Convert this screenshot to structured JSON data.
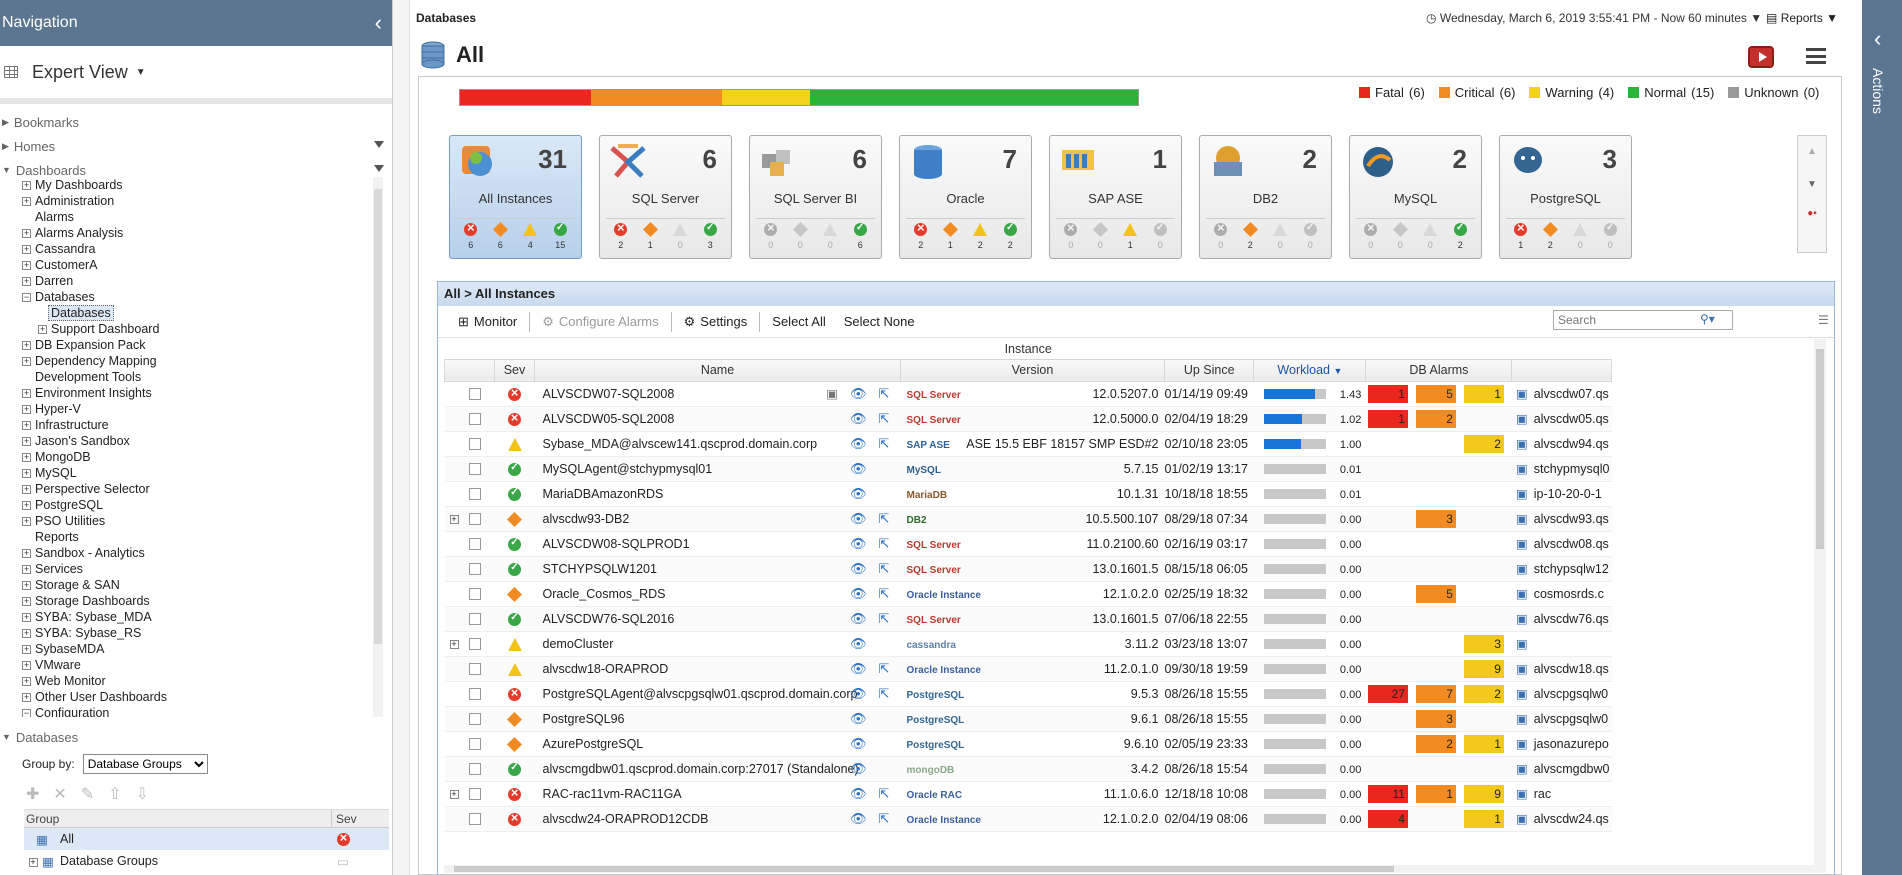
{
  "nav": {
    "title": "Navigation",
    "view": "Expert View",
    "sections": {
      "bookmarks": "Bookmarks",
      "homes": "Homes",
      "dashboards": "Dashboards"
    },
    "dash_items": [
      {
        "label": "My Dashboards",
        "exp": "+",
        "indent": 1
      },
      {
        "label": "Administration",
        "exp": "+",
        "indent": 1
      },
      {
        "label": "Alarms",
        "exp": "",
        "indent": 1
      },
      {
        "label": "Alarms Analysis",
        "exp": "+",
        "indent": 1
      },
      {
        "label": "Cassandra",
        "exp": "+",
        "indent": 1
      },
      {
        "label": "CustomerA",
        "exp": "+",
        "indent": 1
      },
      {
        "label": "Darren",
        "exp": "+",
        "indent": 1
      },
      {
        "label": "Databases",
        "exp": "−",
        "indent": 1
      },
      {
        "label": "Databases",
        "exp": "",
        "indent": 2,
        "sel": true
      },
      {
        "label": "Support Dashboard",
        "exp": "+",
        "indent": 2
      },
      {
        "label": "DB Expansion Pack",
        "exp": "+",
        "indent": 1
      },
      {
        "label": "Dependency Mapping",
        "exp": "+",
        "indent": 1
      },
      {
        "label": "Development Tools",
        "exp": "",
        "indent": 1
      },
      {
        "label": "Environment Insights",
        "exp": "+",
        "indent": 1
      },
      {
        "label": "Hyper-V",
        "exp": "+",
        "indent": 1
      },
      {
        "label": "Infrastructure",
        "exp": "+",
        "indent": 1
      },
      {
        "label": "Jason's Sandbox",
        "exp": "+",
        "indent": 1
      },
      {
        "label": "MongoDB",
        "exp": "+",
        "indent": 1
      },
      {
        "label": "MySQL",
        "exp": "+",
        "indent": 1
      },
      {
        "label": "Perspective Selector",
        "exp": "+",
        "indent": 1
      },
      {
        "label": "PostgreSQL",
        "exp": "+",
        "indent": 1
      },
      {
        "label": "PSO Utilities",
        "exp": "+",
        "indent": 1
      },
      {
        "label": "Reports",
        "exp": "",
        "indent": 1
      },
      {
        "label": "Sandbox - Analytics",
        "exp": "+",
        "indent": 1
      },
      {
        "label": "Services",
        "exp": "+",
        "indent": 1
      },
      {
        "label": "Storage & SAN",
        "exp": "+",
        "indent": 1
      },
      {
        "label": "Storage Dashboards",
        "exp": "+",
        "indent": 1
      },
      {
        "label": "SYBA: Sybase_MDA",
        "exp": "+",
        "indent": 1
      },
      {
        "label": "SYBA: Sybase_RS",
        "exp": "+",
        "indent": 1
      },
      {
        "label": "SybaseMDA",
        "exp": "+",
        "indent": 1
      },
      {
        "label": "VMware",
        "exp": "+",
        "indent": 1
      },
      {
        "label": "Web Monitor",
        "exp": "+",
        "indent": 1
      },
      {
        "label": "Other User Dashboards",
        "exp": "+",
        "indent": 1
      },
      {
        "label": "Configuration",
        "exp": "−",
        "indent": 1
      }
    ],
    "db_section": "Databases",
    "group_by_label": "Group by:",
    "group_by_value": "Database Groups",
    "group_col": "Group",
    "sev_col": "Sev",
    "groups": [
      {
        "label": "All",
        "sel": true
      },
      {
        "label": "Database Groups",
        "sel": false
      }
    ]
  },
  "main": {
    "crumb": "Databases",
    "timerange": "Wednesday, March 6, 2019 3:55:41 PM - Now 60 minutes",
    "reports": "Reports",
    "title": "All"
  },
  "health": {
    "segments": [
      {
        "color": "#e8281f",
        "value": 6
      },
      {
        "color": "#f28b22",
        "value": 6
      },
      {
        "color": "#f2d21c",
        "value": 4
      },
      {
        "color": "#2db23a",
        "value": 15
      }
    ],
    "legend": [
      {
        "label": "Fatal",
        "count": "(6)",
        "color": "#e8281f"
      },
      {
        "label": "Critical",
        "count": "(6)",
        "color": "#f28b22"
      },
      {
        "label": "Warning",
        "count": "(4)",
        "color": "#f2d21c"
      },
      {
        "label": "Normal",
        "count": "(15)",
        "color": "#2db23a"
      },
      {
        "label": "Unknown",
        "count": "(0)",
        "color": "#999999"
      }
    ]
  },
  "tiles": [
    {
      "name": "All Instances",
      "count": "31",
      "sev": [
        "6",
        "6",
        "4",
        "15"
      ],
      "icon": "all-instances-icon",
      "sel": true
    },
    {
      "name": "SQL Server",
      "count": "6",
      "sev": [
        "2",
        "1",
        "0",
        "3"
      ],
      "icon": "sql-server-icon"
    },
    {
      "name": "SQL Server BI",
      "count": "6",
      "sev": [
        "0",
        "0",
        "0",
        "6"
      ],
      "icon": "sql-server-bi-icon"
    },
    {
      "name": "Oracle",
      "count": "7",
      "sev": [
        "2",
        "1",
        "2",
        "2"
      ],
      "icon": "oracle-icon"
    },
    {
      "name": "SAP ASE",
      "count": "1",
      "sev": [
        "0",
        "0",
        "1",
        "0"
      ],
      "icon": "sap-ase-icon"
    },
    {
      "name": "DB2",
      "count": "2",
      "sev": [
        "0",
        "2",
        "0",
        "0"
      ],
      "icon": "db2-icon"
    },
    {
      "name": "MySQL",
      "count": "2",
      "sev": [
        "0",
        "0",
        "0",
        "2"
      ],
      "icon": "mysql-icon"
    },
    {
      "name": "PostgreSQL",
      "count": "3",
      "sev": [
        "1",
        "2",
        "0",
        "0"
      ],
      "icon": "postgresql-icon"
    }
  ],
  "instances": {
    "breadcrumb": "All > All Instances",
    "toolbar": {
      "monitor": "Monitor",
      "configure": "Configure Alarms",
      "settings": "Settings",
      "select_all": "Select All",
      "select_none": "Select None",
      "search_placeholder": "Search"
    },
    "group_header": "Instance",
    "columns": {
      "sev": "Sev",
      "name": "Name",
      "version": "Version",
      "up_since": "Up Since",
      "workload": "Workload",
      "db_alarms": "DB Alarms"
    },
    "rows": [
      {
        "sev": "fatal",
        "name": "ALVSCDW07-SQL2008",
        "product": "SQL Server",
        "version": "12.0.5207.0",
        "up": "01/14/19 09:49",
        "wl": "1.43",
        "wlp": 0.82,
        "af": "1",
        "ac": "5",
        "aw": "1",
        "host": "alvscdw07.qs",
        "ext": true,
        "exp": false,
        "rep": true
      },
      {
        "sev": "fatal",
        "name": "ALVSCDW05-SQL2008",
        "product": "SQL Server",
        "version": "12.0.5000.0",
        "up": "02/04/19 18:29",
        "wl": "1.02",
        "wlp": 0.62,
        "af": "1",
        "ac": "2",
        "aw": "",
        "host": "alvscdw05.qs",
        "ext": true,
        "exp": false
      },
      {
        "sev": "warn",
        "name": "Sybase_MDA@alvscew141.qscprod.domain.corp",
        "product": "SAP ASE",
        "version": "ASE 15.5 EBF 18157 SMP ESD#2",
        "up": "02/10/18 23:05",
        "wl": "1.00",
        "wlp": 0.6,
        "af": "",
        "ac": "",
        "aw": "2",
        "host": "alvscdw94.qs",
        "ext": true,
        "exp": false
      },
      {
        "sev": "norm",
        "name": "MySQLAgent@stchypmysql01",
        "product": "MySQL",
        "version": "5.7.15",
        "up": "01/02/19 13:17",
        "wl": "0.01",
        "wlp": 0,
        "af": "",
        "ac": "",
        "aw": "",
        "host": "stchypmysql0",
        "ext": false,
        "exp": false
      },
      {
        "sev": "norm",
        "name": "MariaDBAmazonRDS",
        "product": "MariaDB",
        "version": "10.1.31",
        "up": "10/18/18 18:55",
        "wl": "0.01",
        "wlp": 0,
        "af": "",
        "ac": "",
        "aw": "",
        "host": "ip-10-20-0-1",
        "ext": false,
        "exp": false
      },
      {
        "sev": "crit",
        "name": "alvscdw93-DB2",
        "product": "DB2",
        "version": "10.5.500.107",
        "up": "08/29/18 07:34",
        "wl": "0.00",
        "wlp": 0,
        "af": "",
        "ac": "3",
        "aw": "",
        "host": "alvscdw93.qs",
        "ext": true,
        "exp": true
      },
      {
        "sev": "norm",
        "name": "ALVSCDW08-SQLPROD1",
        "product": "SQL Server",
        "version": "11.0.2100.60",
        "up": "02/16/19 03:17",
        "wl": "0.00",
        "wlp": 0,
        "af": "",
        "ac": "",
        "aw": "",
        "host": "alvscdw08.qs",
        "ext": true,
        "exp": false
      },
      {
        "sev": "norm",
        "name": "STCHYPSQLW1201",
        "product": "SQL Server",
        "version": "13.0.1601.5",
        "up": "08/15/18 06:05",
        "wl": "0.00",
        "wlp": 0,
        "af": "",
        "ac": "",
        "aw": "",
        "host": "stchypsqlw12",
        "ext": true,
        "exp": false
      },
      {
        "sev": "crit",
        "name": "Oracle_Cosmos_RDS",
        "product": "Oracle Instance",
        "version": "12.1.0.2.0",
        "up": "02/25/19 18:32",
        "wl": "0.00",
        "wlp": 0,
        "af": "",
        "ac": "5",
        "aw": "",
        "host": "cosmosrds.c",
        "ext": true,
        "exp": false
      },
      {
        "sev": "norm",
        "name": "ALVSCDW76-SQL2016",
        "product": "SQL Server",
        "version": "13.0.1601.5",
        "up": "07/06/18 22:55",
        "wl": "0.00",
        "wlp": 0,
        "af": "",
        "ac": "",
        "aw": "",
        "host": "alvscdw76.qs",
        "ext": true,
        "exp": false
      },
      {
        "sev": "warn",
        "name": "demoCluster",
        "product": "cassandra",
        "version": "3.11.2",
        "up": "03/23/18 13:07",
        "wl": "0.00",
        "wlp": 0,
        "af": "",
        "ac": "",
        "aw": "3",
        "host": "",
        "ext": false,
        "exp": true
      },
      {
        "sev": "warn",
        "name": "alvscdw18-ORAPROD",
        "product": "Oracle Instance",
        "version": "11.2.0.1.0",
        "up": "09/30/18 19:59",
        "wl": "0.00",
        "wlp": 0,
        "af": "",
        "ac": "",
        "aw": "9",
        "host": "alvscdw18.qs",
        "ext": true,
        "exp": false
      },
      {
        "sev": "fatal",
        "name": "PostgreSQLAgent@alvscpgsqlw01.qscprod.domain.corp",
        "product": "PostgreSQL",
        "version": "9.5.3",
        "up": "08/26/18 15:55",
        "wl": "0.00",
        "wlp": 0,
        "af": "27",
        "ac": "7",
        "aw": "2",
        "host": "alvscpgsqlw0",
        "ext": true,
        "exp": false
      },
      {
        "sev": "crit",
        "name": "PostgreSQL96",
        "product": "PostgreSQL",
        "version": "9.6.1",
        "up": "08/26/18 15:55",
        "wl": "0.00",
        "wlp": 0,
        "af": "",
        "ac": "3",
        "aw": "",
        "host": "alvscpgsqlw0",
        "ext": false,
        "exp": false
      },
      {
        "sev": "crit",
        "name": "AzurePostgreSQL",
        "product": "PostgreSQL",
        "version": "9.6.10",
        "up": "02/05/19 23:33",
        "wl": "0.00",
        "wlp": 0,
        "af": "",
        "ac": "2",
        "aw": "1",
        "host": "jasonazurepo",
        "ext": false,
        "exp": false
      },
      {
        "sev": "norm",
        "name": "alvscmgdbw01.qscprod.domain.corp:27017 (Standalone)",
        "product": "mongoDB",
        "version": "3.4.2",
        "up": "08/26/18 15:54",
        "wl": "0.00",
        "wlp": 0,
        "af": "",
        "ac": "",
        "aw": "",
        "host": "alvscmgdbw0",
        "ext": false,
        "exp": false
      },
      {
        "sev": "fatal",
        "name": "RAC-rac11vm-RAC11GA",
        "product": "Oracle RAC",
        "version": "11.1.0.6.0",
        "up": "12/18/18 10:08",
        "wl": "0.00",
        "wlp": 0,
        "af": "11",
        "ac": "1",
        "aw": "9",
        "host": "rac",
        "ext": true,
        "exp": true
      },
      {
        "sev": "fatal",
        "name": "alvscdw24-ORAPROD12CDB",
        "product": "Oracle Instance",
        "version": "12.1.0.2.0",
        "up": "02/04/19 08:06",
        "wl": "0.00",
        "wlp": 0,
        "af": "4",
        "ac": "",
        "aw": "1",
        "host": "alvscdw24.qs",
        "ext": true,
        "exp": false
      }
    ]
  },
  "actions": {
    "label": "Actions"
  }
}
